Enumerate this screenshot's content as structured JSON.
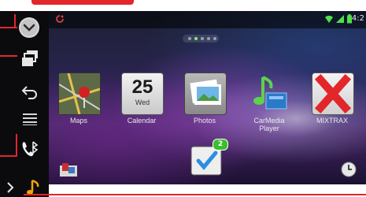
{
  "status_bar": {
    "time": "4:2",
    "icons": [
      "app-indicator-icon",
      "wifi-icon",
      "signal-icon",
      "battery-icon"
    ]
  },
  "home_pages": {
    "count": 5,
    "active_index": 1
  },
  "apps": [
    {
      "label": "Maps",
      "icon": "maps-icon"
    },
    {
      "label": "Calendar",
      "icon": "calendar-icon",
      "day": "25",
      "weekday": "Wed"
    },
    {
      "label": "Photos",
      "icon": "photos-icon"
    },
    {
      "label": "CarMedia\nPlayer",
      "icon": "music-note-icon"
    },
    {
      "label": "MIXTRAX",
      "icon": "mixtrax-icon"
    }
  ],
  "dock": {
    "left_icon": "widget-icon",
    "center_icon": "checkmark-app-icon",
    "badge_count": "2",
    "right_icon": "clock-icon"
  },
  "left_buttons": [
    "dropdown-icon",
    "recent-apps-icon",
    "back-icon",
    "menu-icon",
    "phone-bluetooth-icon",
    "music-source-icon"
  ],
  "colors": {
    "callout": "#e2262a",
    "music_source": "#f0a800",
    "badge": "#3bbd2e",
    "accent_green": "#7cf56a"
  }
}
